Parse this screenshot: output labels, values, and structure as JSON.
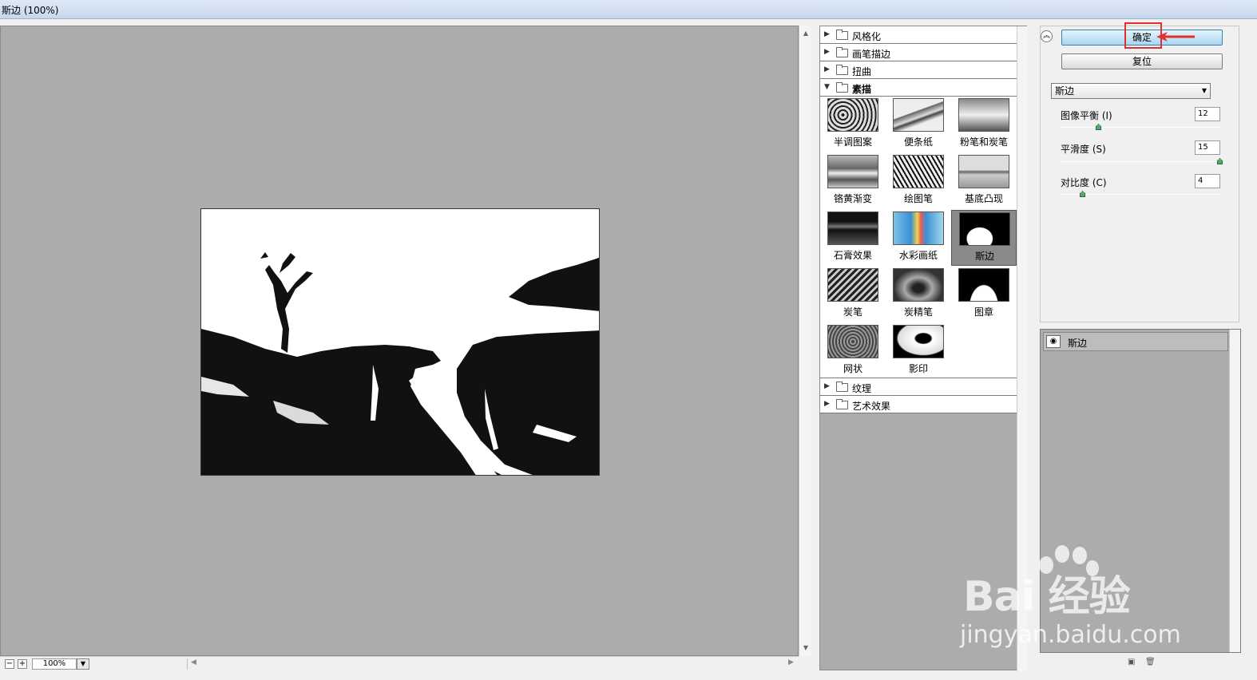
{
  "window": {
    "title": "斯边 (100%)"
  },
  "preview": {
    "zoom": "100%"
  },
  "filters": {
    "categories_top": [
      "风格化",
      "画笔描边",
      "扭曲"
    ],
    "open_category": "素描",
    "thumbnails": [
      "半调图案",
      "便条纸",
      "粉笔和炭笔",
      "铬黄渐变",
      "绘图笔",
      "基底凸现",
      "石膏效果",
      "水彩画纸",
      "斯边",
      "炭笔",
      "炭精笔",
      "图章",
      "网状",
      "影印"
    ],
    "selected": "斯边",
    "categories_bottom": [
      "纹理",
      "艺术效果"
    ]
  },
  "settings": {
    "ok_label": "确定",
    "reset_label": "复位",
    "filter_select": "斯边",
    "params": [
      {
        "label": "图像平衡 (I)",
        "value": "12",
        "fraction": 0.24
      },
      {
        "label": "平滑度 (S)",
        "value": "15",
        "fraction": 1.0
      },
      {
        "label": "对比度 (C)",
        "value": "4",
        "fraction": 0.14
      }
    ]
  },
  "layers": {
    "items": [
      {
        "name": "斯边"
      }
    ]
  },
  "watermark": {
    "brand": "Bai 经验",
    "url": "jingyan.baidu.com"
  },
  "colors": {
    "highlight": "#e03030",
    "ok_button": "#a9d6f2",
    "canvas_bg": "#acacac"
  }
}
